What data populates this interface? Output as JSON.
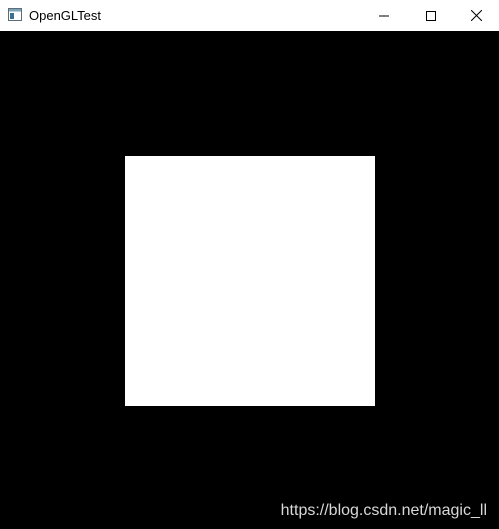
{
  "window": {
    "title": "OpenGLTest",
    "icon": "app-window-icon",
    "controls": {
      "minimize_icon": "minimize-icon",
      "maximize_icon": "maximize-icon",
      "close_icon": "close-icon"
    }
  },
  "viewport": {
    "background_color": "#000000",
    "shape_color": "#ffffff"
  },
  "watermark": {
    "text": "https://blog.csdn.net/magic_ll"
  }
}
